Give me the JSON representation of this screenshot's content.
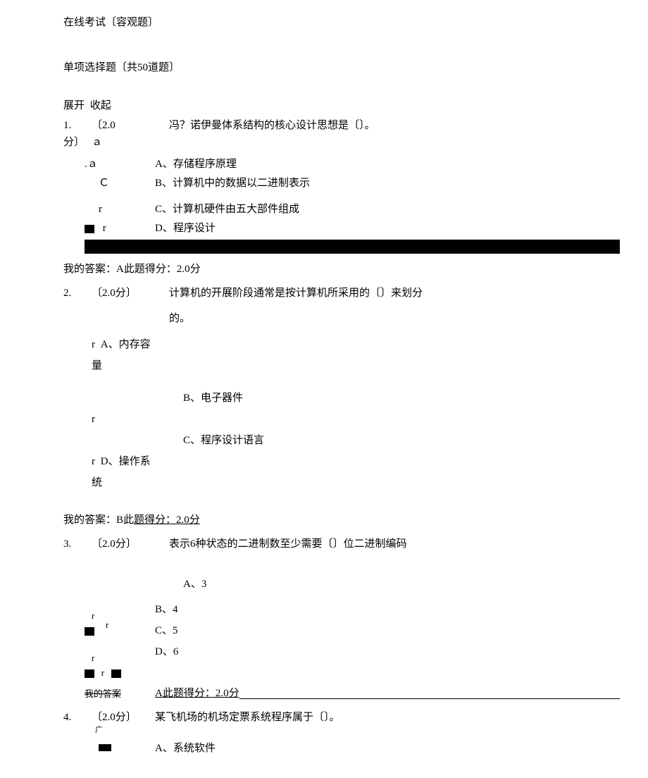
{
  "title": "在线考试〔容观题〕",
  "section_header": "单项选择题〔共50道题〕",
  "expand": "展开",
  "collapse": "收起",
  "q1": {
    "num": "1.",
    "score_open": "〔2.0",
    "stem": "冯？诺伊曼体系结构的核心设计思想是〔〕。",
    "fen_close": "分〕",
    "marker_a": "ａ",
    "opt_marker_a": ".ａ",
    "opt_marker_c": "Ｃ",
    "opt_marker_r1": "r",
    "opt_marker_r2": "r",
    "optA": "A、存储程序原理",
    "optB": "B、计算机中的数据以二进制表示",
    "optC": "C、计算机硬件由五大部件组成",
    "optD": "D、程序设计",
    "answer": "我的答案：A此题得分：2.0分"
  },
  "q2": {
    "num": "2.",
    "score": "〔2.0分〕",
    "stem": "计算机的开展阶段通常是按计算机所采用的〔〕来划分",
    "stem_cont": "的。",
    "marker_r": "r",
    "optA": "A、内存容量",
    "optB": "B、电子器件",
    "optC": "C、程序设计语言",
    "optD": "D、操作系统",
    "answer_prefix": "我的答案：B此",
    "answer_underline": "题得分：2.0分"
  },
  "q3": {
    "num": "3.",
    "score": "〔2.0分〕",
    "stem": "表示6种状态的二进制数至少需要〔〕位二进制编码",
    "marker_r": "r",
    "optA": "A、3",
    "optB": "B、4",
    "optC": "C、5",
    "optD": "D、6",
    "answer_underline": "A此题得分：2.0分"
  },
  "q4": {
    "num": "4.",
    "score": "〔2.0分〕",
    "stem": "某飞机场的机场定票系统程序属于〔〕。",
    "chevron": "广",
    "optA": "A、系统软件"
  }
}
